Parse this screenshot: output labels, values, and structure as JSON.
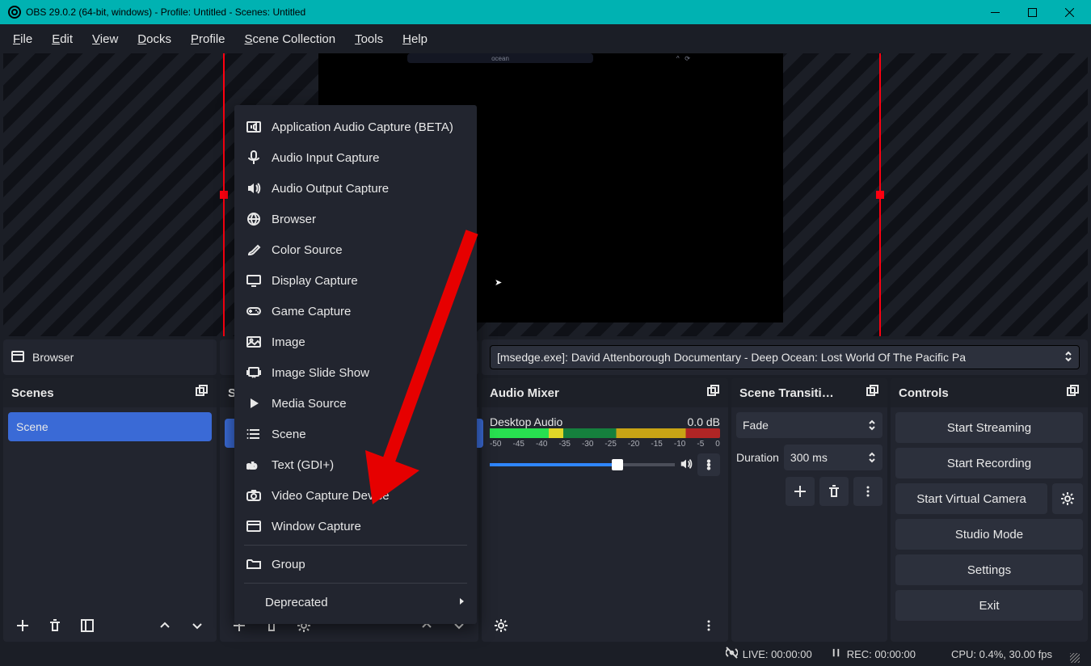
{
  "window": {
    "title": "OBS 29.0.2 (64-bit, windows) - Profile: Untitled - Scenes: Untitled"
  },
  "menubar": [
    "File",
    "Edit",
    "View",
    "Docks",
    "Profile",
    "Scene Collection",
    "Tools",
    "Help"
  ],
  "menubar_underline_index": [
    0,
    0,
    0,
    0,
    0,
    0,
    0,
    0
  ],
  "preview": {
    "tab_label": "ocean"
  },
  "strip": {
    "browser_label": "Browser",
    "dropdown": "[msedge.exe]: David Attenborough Documentary - Deep Ocean: Lost World Of The Pacific Pa"
  },
  "scenes": {
    "title": "Scenes",
    "items": [
      "Scene"
    ]
  },
  "sources": {
    "title": "Sources"
  },
  "mixer": {
    "title": "Audio Mixer",
    "channel_name": "Desktop Audio",
    "channel_db": "0.0 dB",
    "ticks": [
      "-50",
      "-45",
      "-40",
      "-35",
      "-30",
      "-25",
      "-20",
      "-15",
      "-10",
      "-5",
      "0"
    ]
  },
  "transitions": {
    "title": "Scene Transiti…",
    "type": "Fade",
    "duration_label": "Duration",
    "duration_value": "300 ms"
  },
  "controls": {
    "title": "Controls",
    "buttons": [
      "Start Streaming",
      "Start Recording",
      "Start Virtual Camera",
      "Studio Mode",
      "Settings",
      "Exit"
    ]
  },
  "statusbar": {
    "live": "LIVE: 00:00:00",
    "rec": "REC: 00:00:00",
    "cpu": "CPU: 0.4%, 30.00 fps"
  },
  "context_menu": {
    "items": [
      {
        "icon": "app-audio",
        "label": "Application Audio Capture (BETA)"
      },
      {
        "icon": "mic",
        "label": "Audio Input Capture"
      },
      {
        "icon": "speaker",
        "label": "Audio Output Capture"
      },
      {
        "icon": "globe",
        "label": "Browser"
      },
      {
        "icon": "brush",
        "label": "Color Source"
      },
      {
        "icon": "monitor",
        "label": "Display Capture"
      },
      {
        "icon": "gamepad",
        "label": "Game Capture"
      },
      {
        "icon": "image",
        "label": "Image"
      },
      {
        "icon": "slideshow",
        "label": "Image Slide Show"
      },
      {
        "icon": "play",
        "label": "Media Source"
      },
      {
        "icon": "list",
        "label": "Scene"
      },
      {
        "icon": "text",
        "label": "Text (GDI+)"
      },
      {
        "icon": "camera",
        "label": "Video Capture Device"
      },
      {
        "icon": "window",
        "label": "Window Capture"
      }
    ],
    "group_label": "Group",
    "deprecated_label": "Deprecated"
  }
}
